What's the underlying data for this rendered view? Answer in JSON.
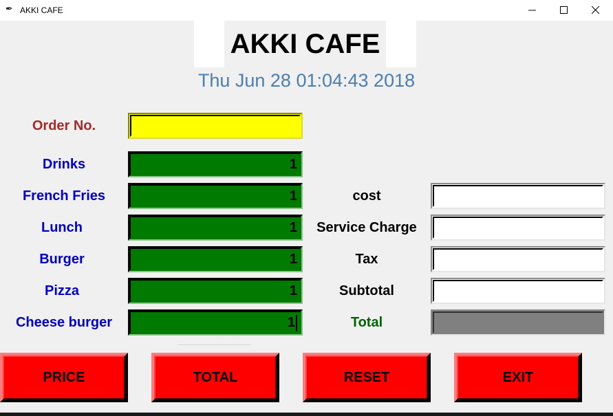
{
  "window": {
    "title": "AKKI CAFE",
    "icon": "feather-icon"
  },
  "header": {
    "title": "AKKI CAFE",
    "datetime": "Thu Jun 28 01:04:43 2018"
  },
  "order": {
    "label": "Order No.",
    "value": ""
  },
  "items": [
    {
      "label": "Drinks",
      "value": "1"
    },
    {
      "label": "French Fries",
      "value": "1"
    },
    {
      "label": "Lunch",
      "value": "1"
    },
    {
      "label": "Burger",
      "value": "1"
    },
    {
      "label": "Pizza",
      "value": "1"
    },
    {
      "label": "Cheese burger",
      "value": "1"
    }
  ],
  "summary": [
    {
      "label": "cost",
      "value": ""
    },
    {
      "label": "Service Charge",
      "value": ""
    },
    {
      "label": "Tax",
      "value": ""
    },
    {
      "label": "Subtotal",
      "value": ""
    },
    {
      "label": "Total",
      "value": ""
    }
  ],
  "buttons": {
    "price": "PRICE",
    "total": "TOTAL",
    "reset": "RESET",
    "exit": "EXIT"
  },
  "colors": {
    "item_label": "#0000cd",
    "order_label": "#a52a2a",
    "entry_bg": "#007a00",
    "order_bg": "#ffff00",
    "button_bg": "#ff0000",
    "total_label": "#006400",
    "datetime": "#4a7fb0"
  }
}
